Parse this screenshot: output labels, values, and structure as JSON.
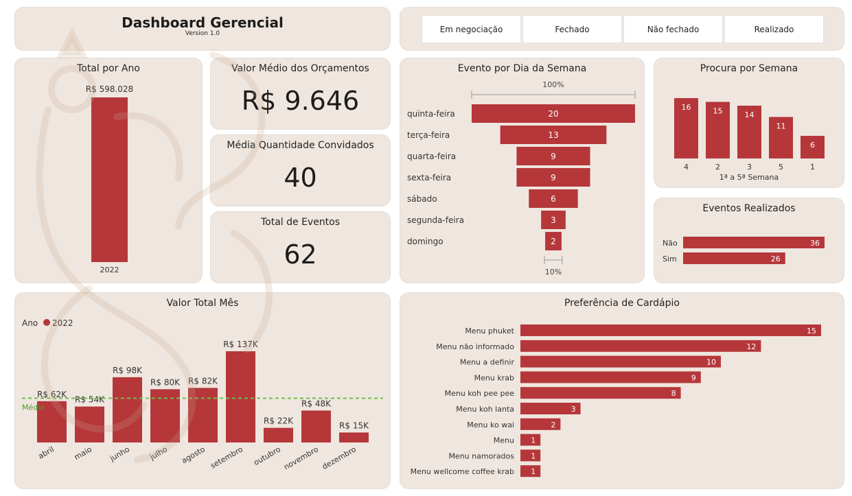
{
  "header": {
    "title": "Dashboard Gerencial",
    "version": "Version 1.0"
  },
  "filters": [
    "Em negociação",
    "Fechado",
    "Não fechado",
    "Realizado"
  ],
  "kpis": {
    "valor_medio": {
      "title": "Valor Médio dos Orçamentos",
      "value": "R$ 9.646"
    },
    "media_convidados": {
      "title": "Média Quantidade Convidados",
      "value": "40"
    },
    "total_eventos": {
      "title": "Total de Eventos",
      "value": "62"
    }
  },
  "colors": {
    "bar": "#b5373a",
    "card": "#efe6df",
    "avg_line": "#6fbf4a"
  },
  "chart_data": [
    {
      "id": "total_ano",
      "type": "bar",
      "title": "Total por Ano",
      "categories": [
        "2022"
      ],
      "values": [
        598028
      ],
      "data_labels": [
        "R$ 598.028"
      ]
    },
    {
      "id": "dia_semana",
      "type": "bar",
      "subtype": "funnel",
      "title": "Evento por Dia da Semana",
      "categories": [
        "quinta-feira",
        "terça-feira",
        "quarta-feira",
        "sexta-feira",
        "sábado",
        "segunda-feira",
        "domingo"
      ],
      "values": [
        20,
        13,
        9,
        9,
        6,
        3,
        2
      ],
      "top_label": "100%",
      "bottom_label": "10%"
    },
    {
      "id": "procura_semana",
      "type": "bar",
      "title": "Procura por Semana",
      "xlabel": "1ª a 5ª Semana",
      "categories": [
        "4",
        "2",
        "3",
        "5",
        "1"
      ],
      "values": [
        16,
        15,
        14,
        11,
        6
      ]
    },
    {
      "id": "eventos_realizados",
      "type": "bar",
      "orientation": "horizontal",
      "title": "Eventos Realizados",
      "categories": [
        "Não",
        "Sim"
      ],
      "values": [
        36,
        26
      ]
    },
    {
      "id": "valor_total_mes",
      "type": "bar",
      "title": "Valor Total Mês",
      "legend": {
        "label": "Ano",
        "series": "2022",
        "position": "top-left"
      },
      "categories": [
        "abril",
        "maio",
        "junho",
        "julho",
        "agosto",
        "setembro",
        "outubro",
        "novembro",
        "dezembro"
      ],
      "values": [
        62,
        54,
        98,
        80,
        82,
        137,
        22,
        48,
        15
      ],
      "data_labels": [
        "R$ 62K",
        "R$ 54K",
        "R$ 98K",
        "R$ 80K",
        "R$ 82K",
        "R$ 137K",
        "R$ 22K",
        "R$ 48K",
        "R$ 15K"
      ],
      "average": {
        "label": "Média",
        "value": 66.4
      }
    },
    {
      "id": "preferencia_cardapio",
      "type": "bar",
      "orientation": "horizontal",
      "title": "Preferência de Cardápio",
      "categories": [
        "Menu phuket",
        "Menu não informado",
        "Menu a definir",
        "Menu krab",
        "Menu koh pee pee",
        "Menu koh lanta",
        "Menu ko wai",
        "Menu",
        "Menu namorados",
        "Menu wellcome coffee krab"
      ],
      "values": [
        15,
        12,
        10,
        9,
        8,
        3,
        2,
        1,
        1,
        1
      ]
    }
  ]
}
